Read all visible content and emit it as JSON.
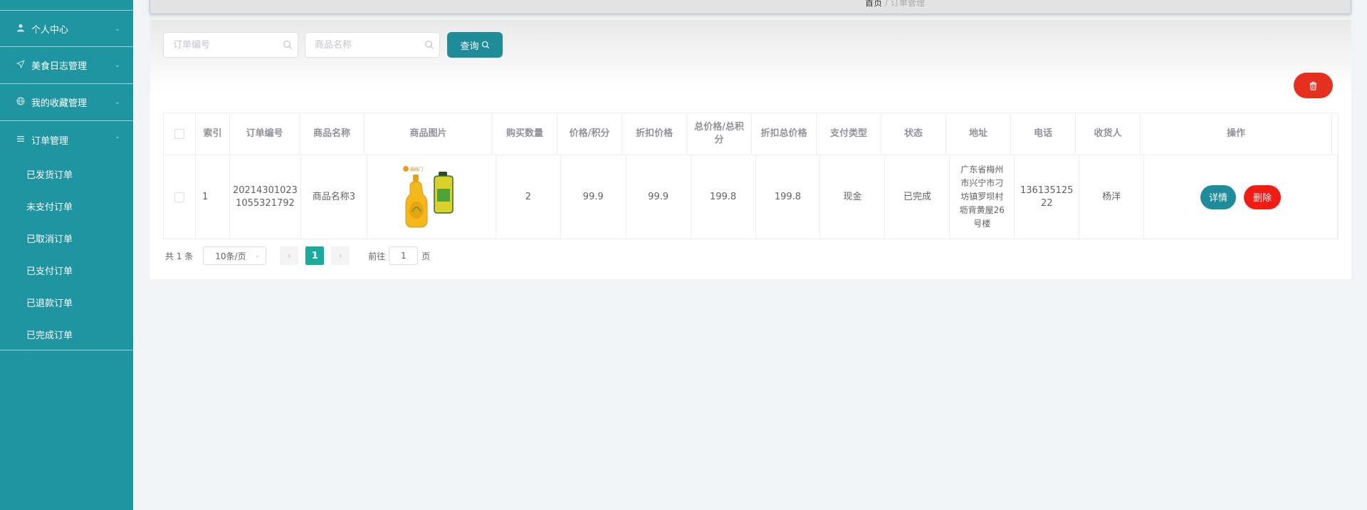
{
  "sidebar": {
    "groups": [
      {
        "label": "个人中心",
        "icon": "user-icon"
      },
      {
        "label": "美食日志管理",
        "icon": "send-icon"
      },
      {
        "label": "我的收藏管理",
        "icon": "globe-icon"
      },
      {
        "label": "订单管理",
        "icon": "menu-icon"
      }
    ],
    "order_sub": [
      "已发货订单",
      "未支付订单",
      "已取消订单",
      "已支付订单",
      "已退款订单",
      "已完成订单"
    ]
  },
  "breadcrumb": {
    "home": "首页",
    "sep": "/",
    "current": "订单管理"
  },
  "search": {
    "order_no_placeholder": "订单编号",
    "product_name_placeholder": "商品名称",
    "query_label": "查询"
  },
  "table": {
    "headers": [
      "索引",
      "订单编号",
      "商品名称",
      "商品图片",
      "购买数量",
      "价格/积分",
      "折扣价格",
      "总价格/总积分",
      "折扣总价格",
      "支付类型",
      "状态",
      "地址",
      "电话",
      "收货人",
      "操作"
    ],
    "rows": [
      {
        "index": "1",
        "order_no": "20214301023 1055321792",
        "product_name": "商品名称3",
        "product_image": "cooking-oil-bottles",
        "quantity": "2",
        "price": "99.9",
        "discount_price": "99.9",
        "total": "199.8",
        "discount_total": "199.8",
        "pay_type": "现金",
        "status": "已完成",
        "address": "广东省梅州市兴宁市刁坊镇罗坝村坜背黄屋26号楼",
        "phone": "136135125 22",
        "receiver": "杨洋",
        "detail_label": "详情",
        "delete_label": "删除"
      }
    ]
  },
  "pagination": {
    "total_text": "共 1 条",
    "page_size": "10条/页",
    "current_page": "1",
    "goto_label": "前往",
    "goto_value": "1",
    "page_suffix": "页"
  },
  "colors": {
    "sidebar": "#1f95a2",
    "primary": "#1f8c9a",
    "danger": "#f21c12",
    "page_active": "#1aab9c"
  }
}
